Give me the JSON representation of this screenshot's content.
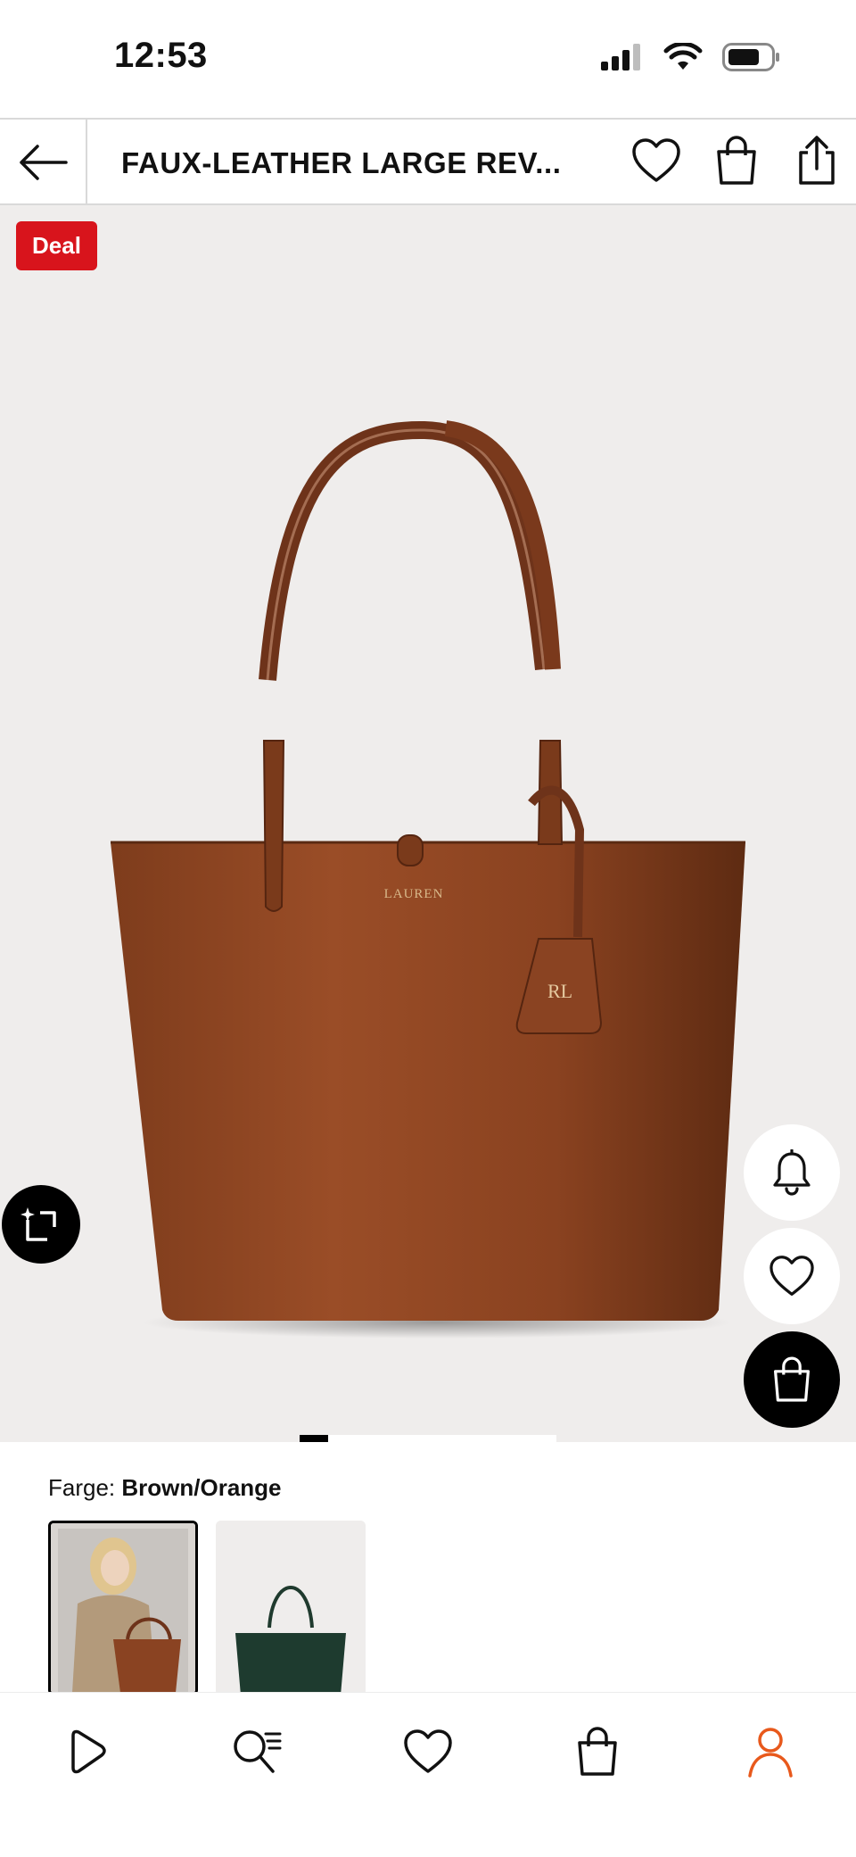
{
  "status_bar": {
    "time": "12:53"
  },
  "header": {
    "title": "FAUX-LEATHER LARGE REV..."
  },
  "product": {
    "deal_badge": "Deal",
    "bag_logo": "LAUREN",
    "tag_logo": "RL",
    "gallery": {
      "total_pages": 9,
      "current_page": 1
    }
  },
  "color": {
    "label": "Farge:",
    "value": "Brown/Orange",
    "options": [
      {
        "name": "Brown/Orange",
        "selected": true
      },
      {
        "name": "Green",
        "selected": false
      }
    ]
  },
  "icons": {
    "back": "arrow-left-icon",
    "wishlist": "heart-icon",
    "cart": "shopping-bag-icon",
    "share": "share-icon",
    "notify": "bell-icon",
    "visual_search": "visual-search-icon",
    "nav": [
      "play-icon",
      "search-list-icon",
      "heart-icon",
      "bag-icon",
      "user-icon"
    ]
  },
  "colors": {
    "deal_red": "#d8141c",
    "accent_orange": "#e8591c",
    "bag_brown": "#8a4422",
    "image_bg": "#efedec"
  }
}
